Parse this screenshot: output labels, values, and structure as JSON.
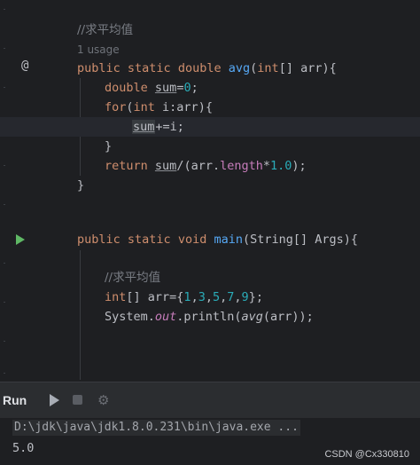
{
  "editor": {
    "comment1": "//求平均值",
    "usage": "1 usage",
    "gutter_at_icon": "@",
    "avg": {
      "kw1": "public",
      "kw2": "static",
      "kw3": "double",
      "name": "avg",
      "p_open": "(",
      "ptype": "int",
      "params_rest": "[] arr){"
    },
    "l_sum": {
      "type": "double",
      "var": "sum",
      "eq": "=",
      "num": "0",
      "semi": ";"
    },
    "l_for": {
      "kw": "for",
      "open": "(",
      "type": "int",
      "rest": " i:arr){"
    },
    "l_add": {
      "var": "sum",
      "rest": "+=i;"
    },
    "close_brace": "}",
    "l_ret": {
      "kw": "return",
      "var": "sum",
      "mid": "/(arr.",
      "field": "length",
      "op": "*",
      "num": "1.0",
      "end": ");"
    },
    "main": {
      "kw1": "public",
      "kw2": "static",
      "kw3": "void",
      "name": "main",
      "params": "(String[] Args){"
    },
    "comment2": "//求平均值",
    "l_arr": {
      "type": "int",
      "mid": "[] arr={",
      "n1": "1",
      "n2": "3",
      "n3": "5",
      "n4": "7",
      "n5": "9",
      "end": "};"
    },
    "l_print": {
      "pre": "System.",
      "out": "out",
      "mid": ".println(",
      "call": "avg",
      "end": "(arr));"
    }
  },
  "run": {
    "title": "Run",
    "command": "D:\\jdk\\java\\jdk1.8.0.231\\bin\\java.exe ...",
    "output": "5.0"
  },
  "watermark": "CSDN @Cx330810",
  "colors": {
    "background": "#1e1f22",
    "keyword": "#cf8e6d",
    "function": "#56a8f5",
    "number": "#2aacb8",
    "field": "#c77dbb",
    "run_icon": "#5fb865"
  }
}
